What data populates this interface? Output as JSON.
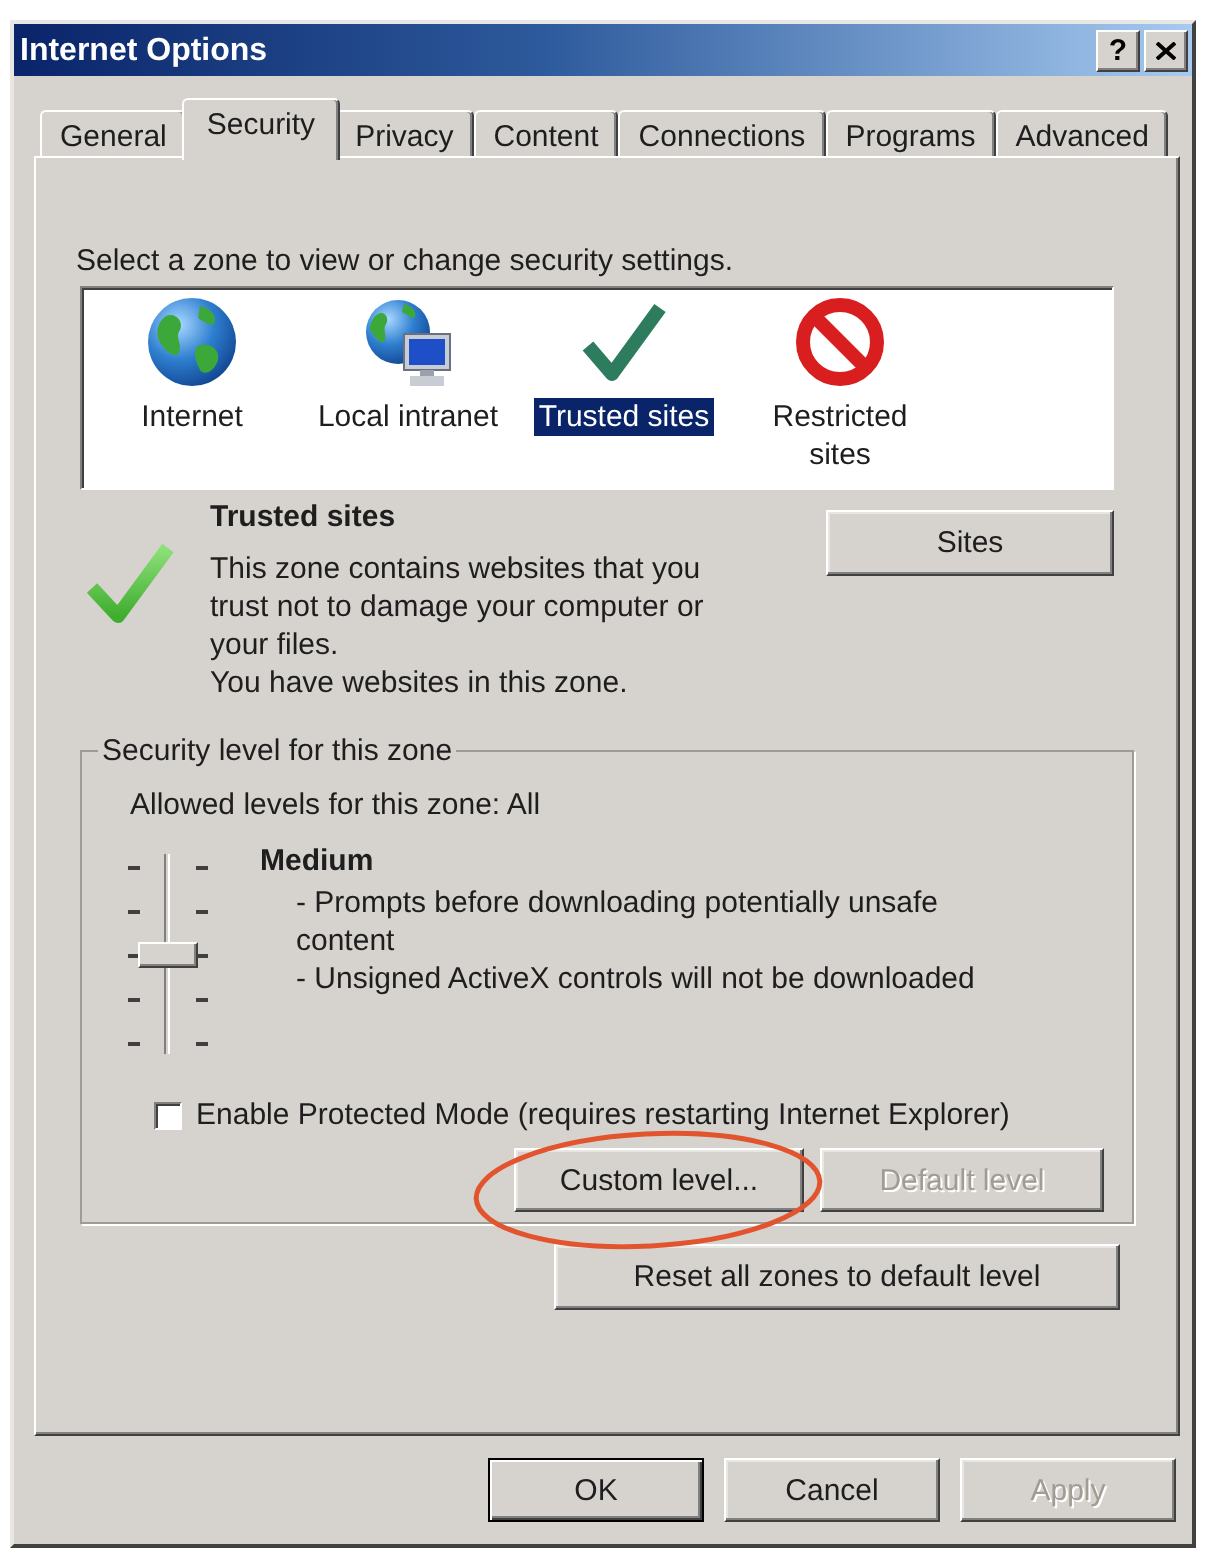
{
  "window": {
    "title": "Internet Options",
    "buttons": [
      {
        "kind": "help",
        "label": "?"
      },
      {
        "kind": "close"
      }
    ]
  },
  "tabs": [
    {
      "label": "General",
      "selected": false
    },
    {
      "label": "Security",
      "selected": true
    },
    {
      "label": "Privacy",
      "selected": false
    },
    {
      "label": "Content",
      "selected": false
    },
    {
      "label": "Connections",
      "selected": false
    },
    {
      "label": "Programs",
      "selected": false
    },
    {
      "label": "Advanced",
      "selected": false
    }
  ],
  "zones": {
    "prompt": "Select a zone to view or change security settings.",
    "items": [
      {
        "kind": "internet",
        "label": "Internet",
        "selected": false
      },
      {
        "kind": "intranet",
        "label": "Local intranet",
        "selected": false
      },
      {
        "kind": "trusted",
        "label": "Trusted sites",
        "selected": true
      },
      {
        "kind": "restricted",
        "label": "Restricted sites",
        "selected": false
      }
    ]
  },
  "zone_detail": {
    "kind": "trusted",
    "title": "Trusted sites",
    "description": "This zone contains websites that you trust not to damage your computer or your files.",
    "note": "You have websites in this zone.",
    "button": {
      "label": "Sites",
      "disabled": false
    }
  },
  "security_level": {
    "legend": "Security level for this zone",
    "allowed": "Allowed levels for this zone: All",
    "level": 0.5,
    "name": "Medium",
    "bullets": [
      "- Prompts before downloading potentially unsafe content",
      "- Unsigned ActiveX controls will not be downloaded"
    ],
    "protected_mode": {
      "label": "Enable Protected Mode (requires restarting Internet Explorer)",
      "checked": false
    },
    "buttons": [
      {
        "label": "Custom level...",
        "disabled": false,
        "circled": true
      },
      {
        "label": "Default level",
        "disabled": true,
        "circled": false
      }
    ]
  },
  "reset_button": {
    "label": "Reset all zones to default level",
    "disabled": false
  },
  "dialog_buttons": [
    {
      "label": "OK",
      "default": true,
      "disabled": false
    },
    {
      "label": "Cancel",
      "default": false,
      "disabled": false
    },
    {
      "label": "Apply",
      "default": false,
      "disabled": true
    }
  ]
}
